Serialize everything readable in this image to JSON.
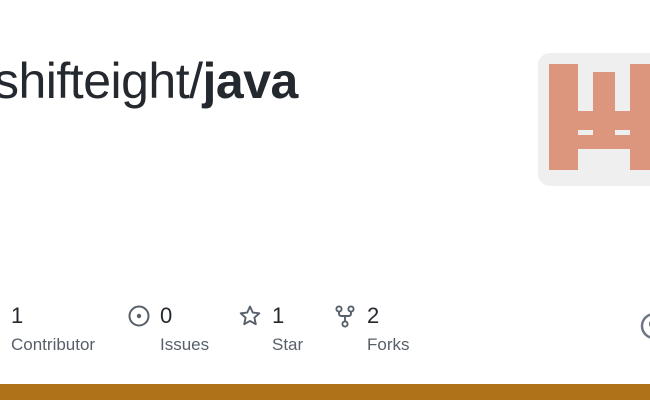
{
  "repo": {
    "owner": "shifteight/",
    "name": "java"
  },
  "stats": {
    "contributors": {
      "count": "1",
      "label": "Contributor",
      "icon": "people-icon"
    },
    "issues": {
      "count": "0",
      "label": "Issues",
      "icon": "issue-opened-icon"
    },
    "stars": {
      "count": "1",
      "label": "Star",
      "icon": "star-icon"
    },
    "forks": {
      "count": "2",
      "label": "Forks",
      "icon": "repo-forked-icon"
    }
  },
  "colors": {
    "language_bar": "#b07219",
    "avatar_bg": "#efefef",
    "avatar_glyph": "#dd967e",
    "title": "#24292f",
    "muted": "#57606a",
    "icon": "#57606a"
  }
}
